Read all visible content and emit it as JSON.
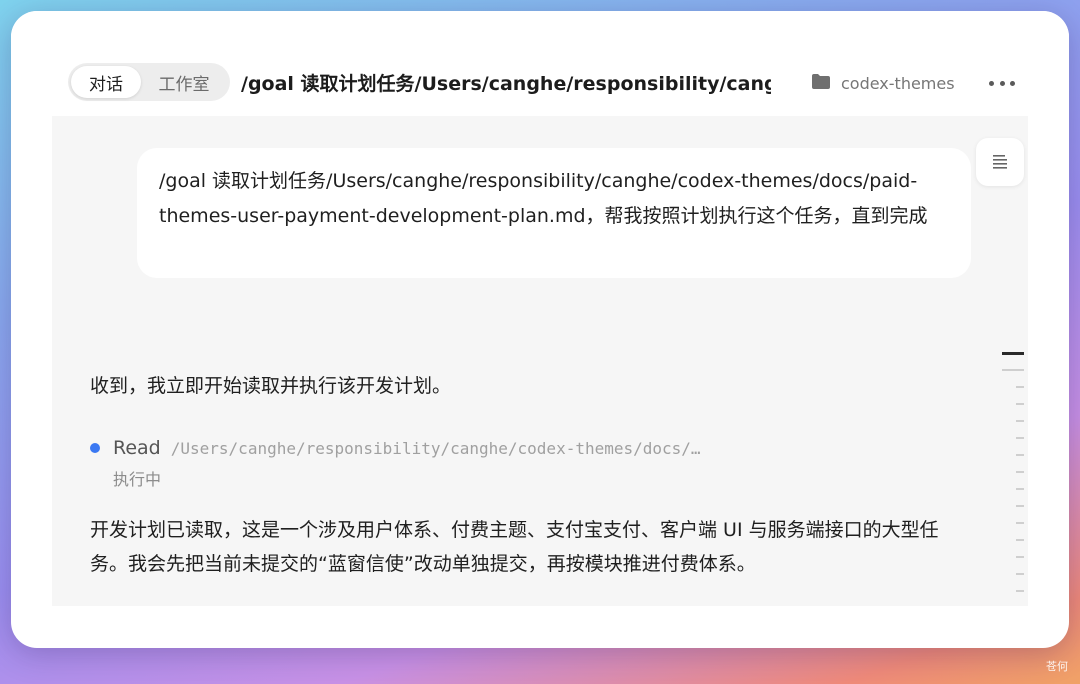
{
  "header": {
    "tabs": [
      {
        "label": "对话",
        "active": true
      },
      {
        "label": "工作室",
        "active": false
      }
    ],
    "title": "/goal 读取计划任务/Users/canghe/responsibility/cang...",
    "project": {
      "icon": "folder-icon",
      "name": "codex-themes"
    },
    "more_icon": "more-horizontal-icon"
  },
  "conversation": {
    "user_message": "/goal 读取计划任务/Users/canghe/responsibility/canghe/codex-themes/docs/paid-themes-user-payment-development-plan.md，帮我按照计划执行这个任务，直到完成",
    "assistant_reply_1": "收到，我立即开始读取并执行该开发计划。",
    "tool_call": {
      "name": "Read",
      "path": "/Users/canghe/responsibility/canghe/codex-themes/docs/…",
      "status": "执行中",
      "status_color": "#3a78f2"
    },
    "assistant_reply_2": "开发计划已读取，这是一个涉及用户体系、付费主题、支付宝支付、客户端 UI 与服务端接口的大型任务。我会先把当前未提交的“蓝窗信使”改动单独提交，再按模块推进付费体系。"
  },
  "outline_icon": "outline-list-icon",
  "watermark": "苍何"
}
